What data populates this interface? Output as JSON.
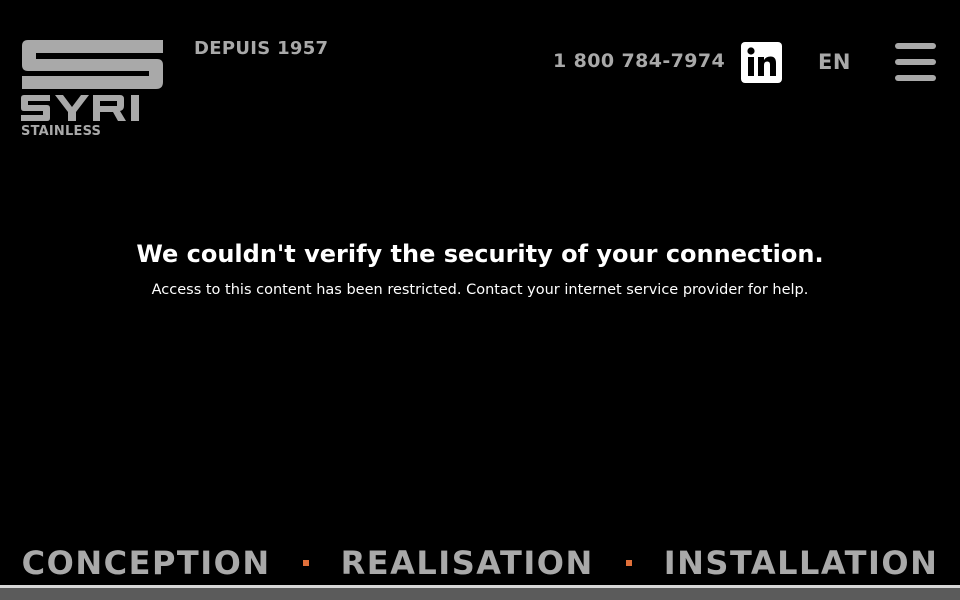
{
  "brand": {
    "logo_text": "SYRI",
    "logo_sub": "STAINLESS",
    "since": "DEPUIS 1957"
  },
  "header": {
    "phone": "1 800 784-7974",
    "social_icon": "linkedin-icon",
    "language": "EN",
    "menu_icon": "hamburger-menu-icon"
  },
  "message": {
    "title": "We couldn't verify the security of your connection.",
    "body": "Access to this content has been restricted. Contact your internet service provider for help."
  },
  "tagline": {
    "items": [
      "CONCEPTION",
      "REALISATION",
      "INSTALLATION"
    ]
  },
  "colors": {
    "background": "#000000",
    "grey_text": "#a9a9a9",
    "accent_dot": "#e0703a",
    "footer_bar": "#5b5b5b"
  }
}
